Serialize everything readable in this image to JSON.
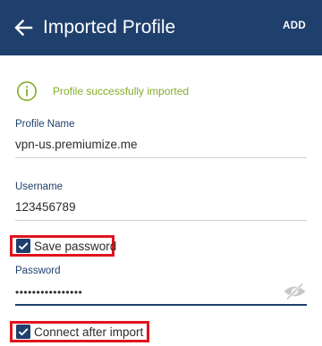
{
  "header": {
    "title": "Imported Profile",
    "action": "ADD",
    "color": "#1f3f6c"
  },
  "status": {
    "icon": "info-circle-icon",
    "message": "Profile successfully imported",
    "color": "#82ae27"
  },
  "profile_name": {
    "label": "Profile Name",
    "value": "vpn-us.premiumize.me"
  },
  "username": {
    "label": "Username",
    "value": "123456789"
  },
  "save_password": {
    "label": "Save password",
    "checked": true
  },
  "password": {
    "label": "Password",
    "value": "••••••••••••••••",
    "toggle_icon": "eye-off-icon"
  },
  "connect_after_import": {
    "label": "Connect after import",
    "checked": true
  },
  "highlight_color": "#e0141e"
}
